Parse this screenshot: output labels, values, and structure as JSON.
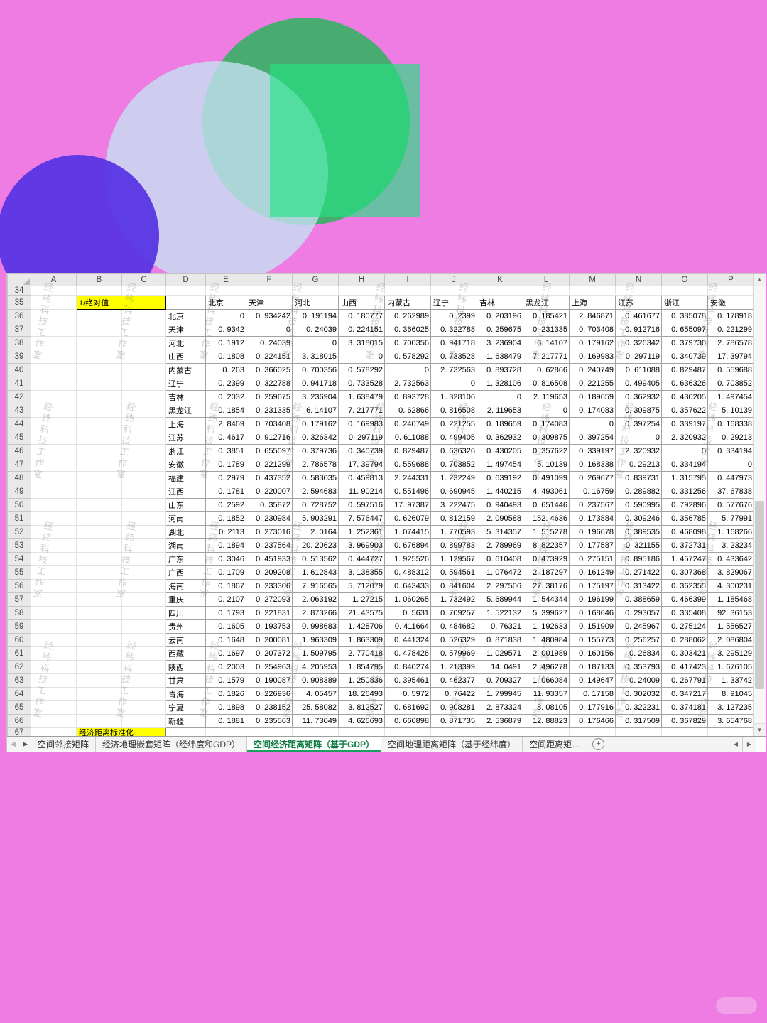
{
  "app": {
    "watermark_text": "经纬科技工作室",
    "colors": {
      "background_pink": "#ee7ce2",
      "highlight_yellow": "#ffff00",
      "active_tab_green": "#0e7c42"
    }
  },
  "icons": {
    "nav_left": "◀",
    "nav_right": "▶",
    "up": "▲",
    "down": "▼",
    "plus": "+"
  },
  "grid": {
    "row_start": 34,
    "row_end": 67,
    "column_letters": [
      "A",
      "B",
      "C",
      "D",
      "E",
      "F",
      "G",
      "H",
      "I",
      "J",
      "K",
      "L",
      "M",
      "N",
      "O",
      "P"
    ],
    "label_cell": {
      "cell": "B35",
      "text": "1/绝对值"
    },
    "bottom_label": {
      "cell": "B67",
      "text": "经济距离标准化"
    },
    "matrix": {
      "column_headers": [
        "北京",
        "天津",
        "河北",
        "山西",
        "内蒙古",
        "辽宁",
        "吉林",
        "黑龙江",
        "上海",
        "江苏",
        "浙江",
        "安徽"
      ],
      "rows": [
        {
          "name": "北京",
          "values": [
            "0",
            "0.934242",
            "0.191194",
            "0.180777",
            "0.262989",
            "0.2399",
            "0.203196",
            "0.185421",
            "2.846871",
            "0.461677",
            "0.385078",
            "0.178918"
          ]
        },
        {
          "name": "天津",
          "values": [
            "0.9342",
            "0",
            "0.24039",
            "0.224151",
            "0.366025",
            "0.322788",
            "0.259675",
            "0.231335",
            "0.703408",
            "0.912716",
            "0.655097",
            "0.221299"
          ]
        },
        {
          "name": "河北",
          "values": [
            "0.1912",
            "0.24039",
            "0",
            "3.318015",
            "0.700356",
            "0.941718",
            "3.236904",
            "6.14107",
            "0.179162",
            "0.326342",
            "0.379736",
            "2.786578"
          ]
        },
        {
          "name": "山西",
          "values": [
            "0.1808",
            "0.224151",
            "3.318015",
            "0",
            "0.578292",
            "0.733528",
            "1.638479",
            "7.217771",
            "0.169983",
            "0.297119",
            "0.340739",
            "17.39794"
          ]
        },
        {
          "name": "内蒙古",
          "values": [
            "0.263",
            "0.366025",
            "0.700356",
            "0.578292",
            "0",
            "2.732563",
            "0.893728",
            "0.62866",
            "0.240749",
            "0.611088",
            "0.829487",
            "0.559688"
          ]
        },
        {
          "name": "辽宁",
          "values": [
            "0.2399",
            "0.322788",
            "0.941718",
            "0.733528",
            "2.732563",
            "0",
            "1.328106",
            "0.816508",
            "0.221255",
            "0.499405",
            "0.636326",
            "0.703852"
          ]
        },
        {
          "name": "吉林",
          "values": [
            "0.2032",
            "0.259675",
            "3.236904",
            "1.638479",
            "0.893728",
            "1.328106",
            "0",
            "2.119653",
            "0.189659",
            "0.362932",
            "0.430205",
            "1.497454"
          ]
        },
        {
          "name": "黑龙江",
          "values": [
            "0.1854",
            "0.231335",
            "6.14107",
            "7.217771",
            "0.62866",
            "0.816508",
            "2.119653",
            "0",
            "0.174083",
            "0.309875",
            "0.357622",
            "5.10139"
          ]
        },
        {
          "name": "上海",
          "values": [
            "2.8469",
            "0.703408",
            "0.179162",
            "0.169983",
            "0.240749",
            "0.221255",
            "0.189659",
            "0.174083",
            "0",
            "0.397254",
            "0.339197",
            "0.168338"
          ]
        },
        {
          "name": "江苏",
          "values": [
            "0.4617",
            "0.912716",
            "0.326342",
            "0.297119",
            "0.611088",
            "0.499405",
            "0.362932",
            "0.309875",
            "0.397254",
            "0",
            "2.320932",
            "0.29213"
          ]
        },
        {
          "name": "浙江",
          "values": [
            "0.3851",
            "0.655097",
            "0.379736",
            "0.340739",
            "0.829487",
            "0.636326",
            "0.430205",
            "0.357622",
            "0.339197",
            "2.320932",
            "0",
            "0.334194"
          ]
        },
        {
          "name": "安徽",
          "values": [
            "0.1789",
            "0.221299",
            "2.786578",
            "17.39794",
            "0.559688",
            "0.703852",
            "1.497454",
            "5.10139",
            "0.168338",
            "0.29213",
            "0.334194",
            "0"
          ]
        },
        {
          "name": "福建",
          "values": [
            "0.2979",
            "0.437352",
            "0.583035",
            "0.459813",
            "2.244331",
            "1.232249",
            "0.639192",
            "0.491099",
            "0.269677",
            "0.839731",
            "1.315795",
            "0.447973"
          ]
        },
        {
          "name": "江西",
          "values": [
            "0.1781",
            "0.220007",
            "2.594683",
            "11.90214",
            "0.551496",
            "0.690945",
            "1.440215",
            "4.493061",
            "0.16759",
            "0.289882",
            "0.331256",
            "37.67838"
          ]
        },
        {
          "name": "山东",
          "values": [
            "0.2592",
            "0.35872",
            "0.728752",
            "0.597516",
            "17.97387",
            "3.222475",
            "0.940493",
            "0.651446",
            "0.237567",
            "0.590995",
            "0.792896",
            "0.577676"
          ]
        },
        {
          "name": "河南",
          "values": [
            "0.1852",
            "0.230984",
            "5.903291",
            "7.576447",
            "0.626079",
            "0.812159",
            "2.090588",
            "152.4636",
            "0.173884",
            "0.309246",
            "0.356785",
            "5.77991"
          ]
        },
        {
          "name": "湖北",
          "values": [
            "0.2113",
            "0.273016",
            "2.0164",
            "1.252361",
            "1.074415",
            "1.770593",
            "5.314357",
            "1.515278",
            "0.196678",
            "0.389535",
            "0.468098",
            "1.168266"
          ]
        },
        {
          "name": "湖南",
          "values": [
            "0.1894",
            "0.237564",
            "20.20623",
            "3.969903",
            "0.676894",
            "0.899783",
            "2.789969",
            "8.822357",
            "0.177587",
            "0.321155",
            "0.372731",
            "3.23234"
          ]
        },
        {
          "name": "广东",
          "values": [
            "0.3046",
            "0.451933",
            "0.513562",
            "0.444727",
            "1.925526",
            "1.129567",
            "0.610408",
            "0.473929",
            "0.275151",
            "0.895186",
            "1.457247",
            "0.433642"
          ]
        },
        {
          "name": "广西",
          "values": [
            "0.1709",
            "0.209208",
            "1.612843",
            "3.138355",
            "0.488312",
            "0.594561",
            "1.076472",
            "2.187297",
            "0.161249",
            "0.271422",
            "0.307368",
            "3.829067"
          ]
        },
        {
          "name": "海南",
          "values": [
            "0.1867",
            "0.233306",
            "7.916565",
            "5.712079",
            "0.643433",
            "0.841604",
            "2.297506",
            "27.38176",
            "0.175197",
            "0.313422",
            "0.362355",
            "4.300231"
          ]
        },
        {
          "name": "重庆",
          "values": [
            "0.2107",
            "0.272093",
            "2.063192",
            "1.27215",
            "1.060265",
            "1.732492",
            "5.689944",
            "1.544344",
            "0.196199",
            "0.388659",
            "0.466399",
            "1.185468"
          ]
        },
        {
          "name": "四川",
          "values": [
            "0.1793",
            "0.221831",
            "2.873266",
            "21.43575",
            "0.5631",
            "0.709257",
            "1.522132",
            "5.399627",
            "0.168646",
            "0.293057",
            "0.335408",
            "92.36153"
          ]
        },
        {
          "name": "贵州",
          "values": [
            "0.1605",
            "0.193753",
            "0.998683",
            "1.428706",
            "0.411664",
            "0.484682",
            "0.76321",
            "1.192633",
            "0.151909",
            "0.245967",
            "0.275124",
            "1.556527"
          ]
        },
        {
          "name": "云南",
          "values": [
            "0.1648",
            "0.200081",
            "1.963309",
            "1.863309",
            "0.441324",
            "0.526329",
            "0.871838",
            "1.480984",
            "0.155773",
            "0.256257",
            "0.288062",
            "2.086804"
          ]
        },
        {
          "name": "西藏",
          "values": [
            "0.1697",
            "0.207372",
            "1.509795",
            "2.770418",
            "0.478426",
            "0.579969",
            "1.029571",
            "2.001989",
            "0.160156",
            "0.26834",
            "0.303421",
            "3.295129"
          ]
        },
        {
          "name": "陕西",
          "values": [
            "0.2003",
            "0.254963",
            "4.205953",
            "1.854795",
            "0.840274",
            "1.213399",
            "14.0491",
            "2.496278",
            "0.187133",
            "0.353793",
            "0.417423",
            "1.676105"
          ]
        },
        {
          "name": "甘肃",
          "values": [
            "0.1579",
            "0.190087",
            "0.908389",
            "1.250836",
            "0.395461",
            "0.462377",
            "0.709327",
            "1.066084",
            "0.149647",
            "0.24009",
            "0.267791",
            "1.33742"
          ]
        },
        {
          "name": "青海",
          "values": [
            "0.1826",
            "0.226936",
            "4.05457",
            "18.26493",
            "0.5972",
            "0.76422",
            "1.799945",
            "11.93357",
            "0.17158",
            "0.302032",
            "0.347217",
            "8.91045"
          ]
        },
        {
          "name": "宁夏",
          "values": [
            "0.1898",
            "0.238152",
            "25.58082",
            "3.812527",
            "0.681692",
            "0.908281",
            "2.873324",
            "8.08105",
            "0.177916",
            "0.322231",
            "0.374181",
            "3.127235"
          ]
        },
        {
          "name": "新疆",
          "values": [
            "0.1881",
            "0.235563",
            "11.73049",
            "4.626693",
            "0.660898",
            "0.871735",
            "2.536879",
            "12.88823",
            "0.176466",
            "0.317509",
            "0.367829",
            "3.654768"
          ]
        }
      ]
    }
  },
  "tabbar": {
    "tabs": [
      {
        "label": "空间邻接矩阵",
        "active": false
      },
      {
        "label": "经济地理嵌套矩阵（经纬度和GDP）",
        "active": false
      },
      {
        "label": "空间经济距离矩阵（基于GDP）",
        "active": true
      },
      {
        "label": "空间地理距离矩阵（基于经纬度）",
        "active": false
      },
      {
        "label": "空间距离矩…",
        "active": false
      }
    ]
  }
}
